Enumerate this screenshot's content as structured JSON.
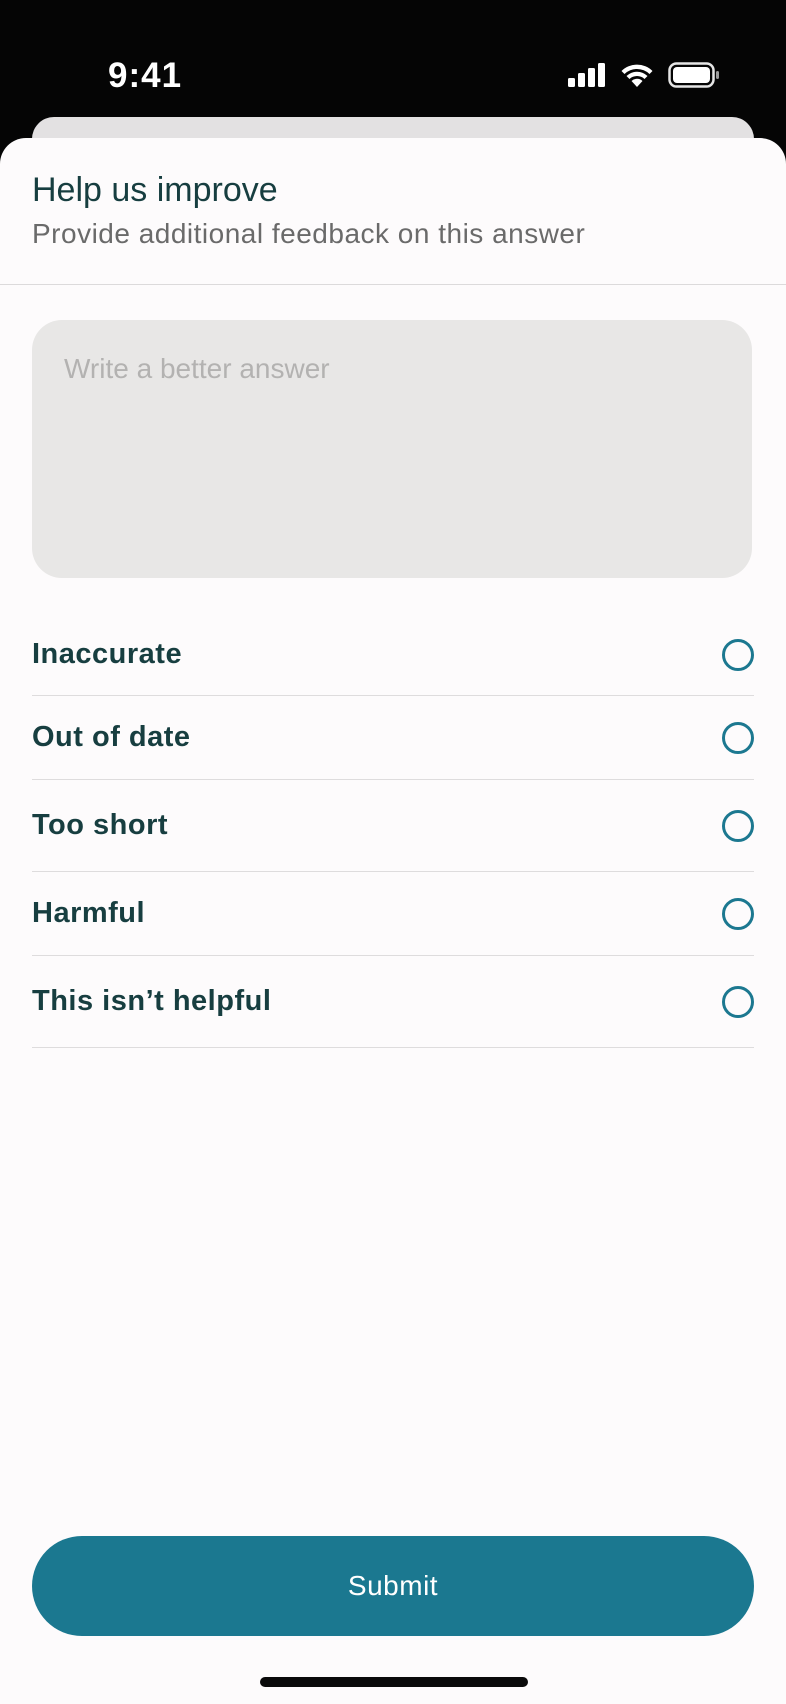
{
  "status_bar": {
    "time": "9:41",
    "icons": [
      "cellular-signal-icon",
      "wifi-icon",
      "battery-icon"
    ]
  },
  "sheet": {
    "title": "Help us improve",
    "subtitle": "Provide additional feedback on this answer",
    "answer_input": {
      "value": "",
      "placeholder": "Write a better answer"
    },
    "options": [
      {
        "label": "Inaccurate",
        "selected": false
      },
      {
        "label": "Out of date",
        "selected": false
      },
      {
        "label": "Too short",
        "selected": false
      },
      {
        "label": "Harmful",
        "selected": false
      },
      {
        "label": "This isn’t helpful",
        "selected": false
      }
    ],
    "submit_label": "Submit"
  },
  "colors": {
    "accent": "#1b7890",
    "title_text": "#173e40",
    "subtitle_text": "#6a6a6a",
    "sheet_background": "#fdfbfc",
    "input_background": "#e8e7e6"
  }
}
